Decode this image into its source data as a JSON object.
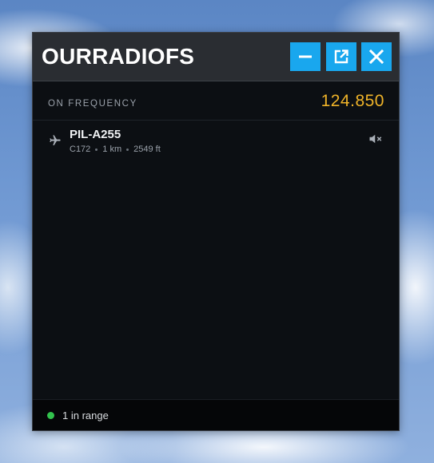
{
  "window": {
    "title": "OURRADIOFS",
    "accent_color": "#19a7ee",
    "buttons": {
      "minimize_icon": "minimize-icon",
      "popout_icon": "popout-icon",
      "close_icon": "close-icon"
    }
  },
  "frequency": {
    "label": "ON FREQUENCY",
    "value": "124.850",
    "value_color": "#f0b429"
  },
  "aircraft": [
    {
      "callsign": "PIL-A255",
      "type": "C172",
      "distance": "1 km",
      "altitude": "2549 ft",
      "icon": "airplane-icon",
      "audio_icon": "mute-icon"
    }
  ],
  "footer": {
    "status_color": "#32c24d",
    "status_text": "1 in range"
  }
}
